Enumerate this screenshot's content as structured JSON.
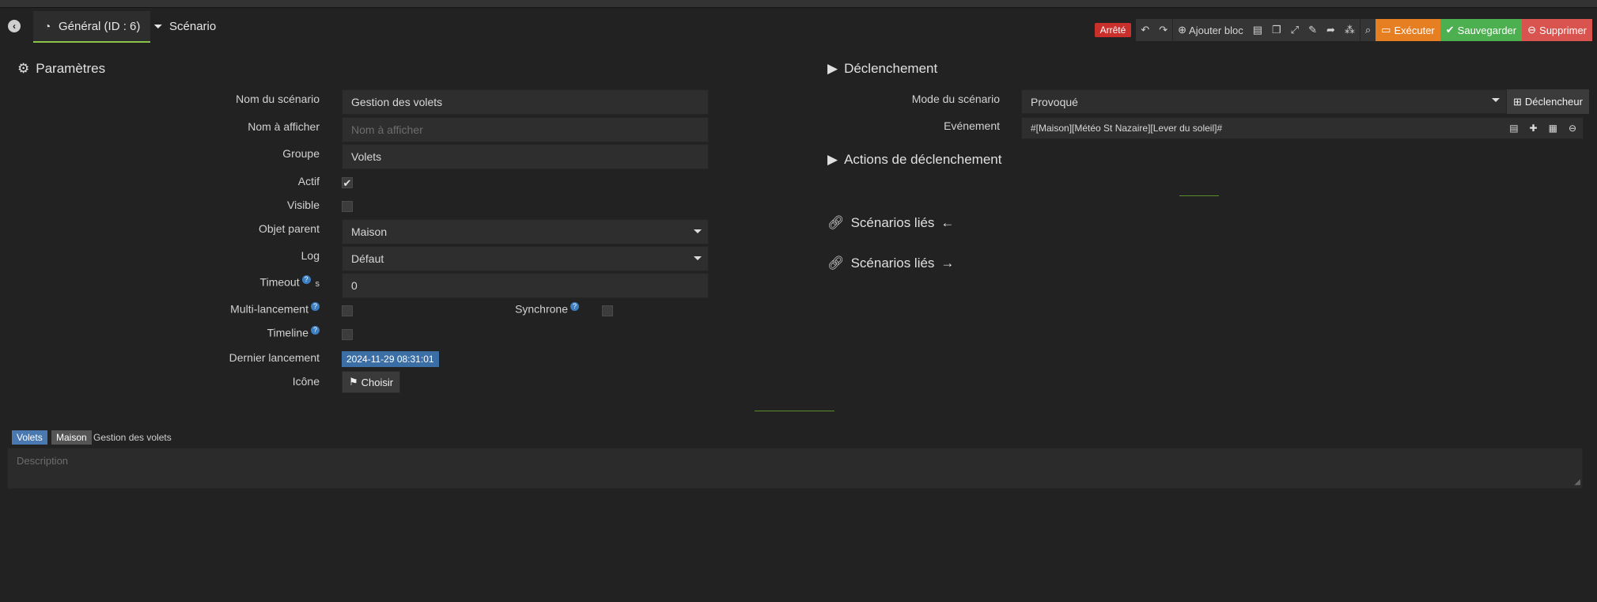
{
  "tabs": {
    "general_label": "Général (ID : 6)",
    "scenario_label": "Scénario"
  },
  "toolbar": {
    "status": "Arrêté",
    "add_block": "Ajouter bloc",
    "execute": "Exécuter",
    "save": "Sauvegarder",
    "delete": "Supprimer"
  },
  "params": {
    "title": "Paramètres",
    "name_label": "Nom du scénario",
    "name_value": "Gestion des volets",
    "display_label": "Nom à afficher",
    "display_placeholder": "Nom à afficher",
    "group_label": "Groupe",
    "group_value": "Volets",
    "active_label": "Actif",
    "visible_label": "Visible",
    "parent_label": "Objet parent",
    "parent_value": "Maison",
    "log_label": "Log",
    "log_value": "Défaut",
    "timeout_label": "Timeout",
    "timeout_unit": "s",
    "timeout_value": "0",
    "multi_label": "Multi-lancement",
    "sync_label": "Synchrone",
    "timeline_label": "Timeline",
    "last_run_label": "Dernier lancement",
    "last_run_value": "2024-11-29 08:31:01",
    "icon_label": "Icône",
    "choose_label": "Choisir"
  },
  "trigger": {
    "title": "Déclenchement",
    "mode_label": "Mode du scénario",
    "mode_value": "Provoqué",
    "trigger_button": "Déclencheur",
    "event_label": "Evénement",
    "event_value": "#[Maison][Météo St Nazaire][Lever du soleil]#",
    "actions_title": "Actions de déclenchement",
    "linked_title_1": "Scénarios liés",
    "linked_title_2": "Scénarios liés"
  },
  "footer": {
    "tag_group": "Volets",
    "tag_object": "Maison",
    "tag_name": "Gestion des volets",
    "description_placeholder": "Description"
  },
  "state": {
    "active_checked": true,
    "visible_checked": false,
    "multi_checked": false,
    "sync_checked": false,
    "timeline_checked": false
  },
  "colors": {
    "background": "#222222",
    "status_red": "#c9302c",
    "execute_orange": "#e67e22",
    "save_green": "#4caf50",
    "delete_red": "#d9534f",
    "timestamp_blue": "#3c6ea6"
  }
}
